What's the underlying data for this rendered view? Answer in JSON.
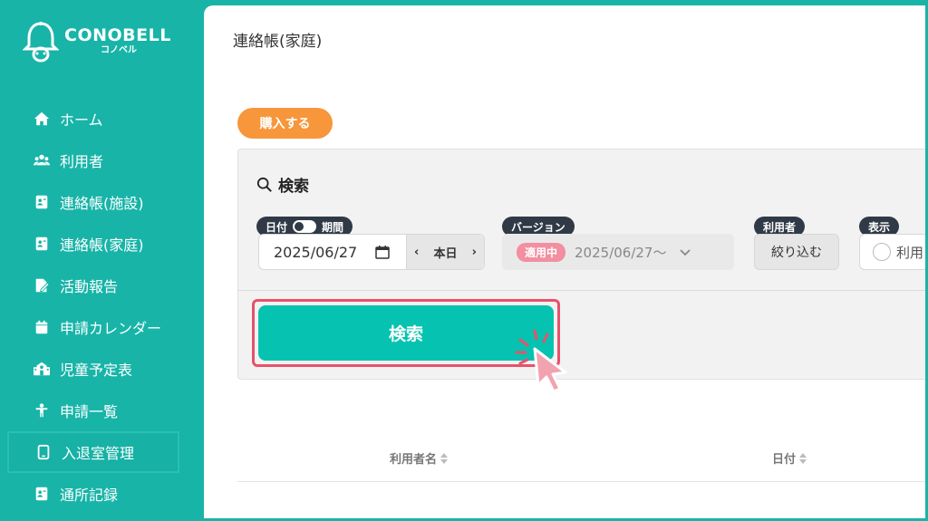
{
  "brand": {
    "name": "CONOBELL",
    "sub": "コノベル"
  },
  "sidebar": {
    "items": [
      {
        "label": "ホーム",
        "icon": "home-icon"
      },
      {
        "label": "利用者",
        "icon": "users-icon"
      },
      {
        "label": "連絡帳(施設)",
        "icon": "contact-book-icon"
      },
      {
        "label": "連絡帳(家庭)",
        "icon": "contact-book-icon"
      },
      {
        "label": "活動報告",
        "icon": "edit-document-icon"
      },
      {
        "label": "申請カレンダー",
        "icon": "calendar-icon"
      },
      {
        "label": "児童予定表",
        "icon": "school-icon"
      },
      {
        "label": "申請一覧",
        "icon": "person-icon"
      },
      {
        "label": "入退室管理",
        "icon": "tablet-icon"
      },
      {
        "label": "通所記録",
        "icon": "contact-book-icon"
      }
    ],
    "active_index": 8
  },
  "main": {
    "title": "連絡帳(家庭)",
    "buy_label": "購入する",
    "search": {
      "heading": "検索",
      "date_pill_left": "日付",
      "date_pill_right": "期間",
      "date_value": "2025/06/27",
      "today_label": "本日",
      "version_pill": "バージョン",
      "version_badge": "適用中",
      "version_value": "2025/06/27〜",
      "user_pill": "利用者",
      "filter_label": "絞り込む",
      "display_pill": "表示",
      "display_option": "利用",
      "search_button": "検索"
    },
    "table": {
      "columns": [
        "利用者名",
        "日付"
      ]
    }
  },
  "colors": {
    "teal": "#18b4a8",
    "button_teal": "#05c3b0",
    "orange": "#f7963a",
    "pill_dark": "#2f3a46",
    "badge_pink": "#f28fa0",
    "highlight_red": "#e8526a"
  }
}
